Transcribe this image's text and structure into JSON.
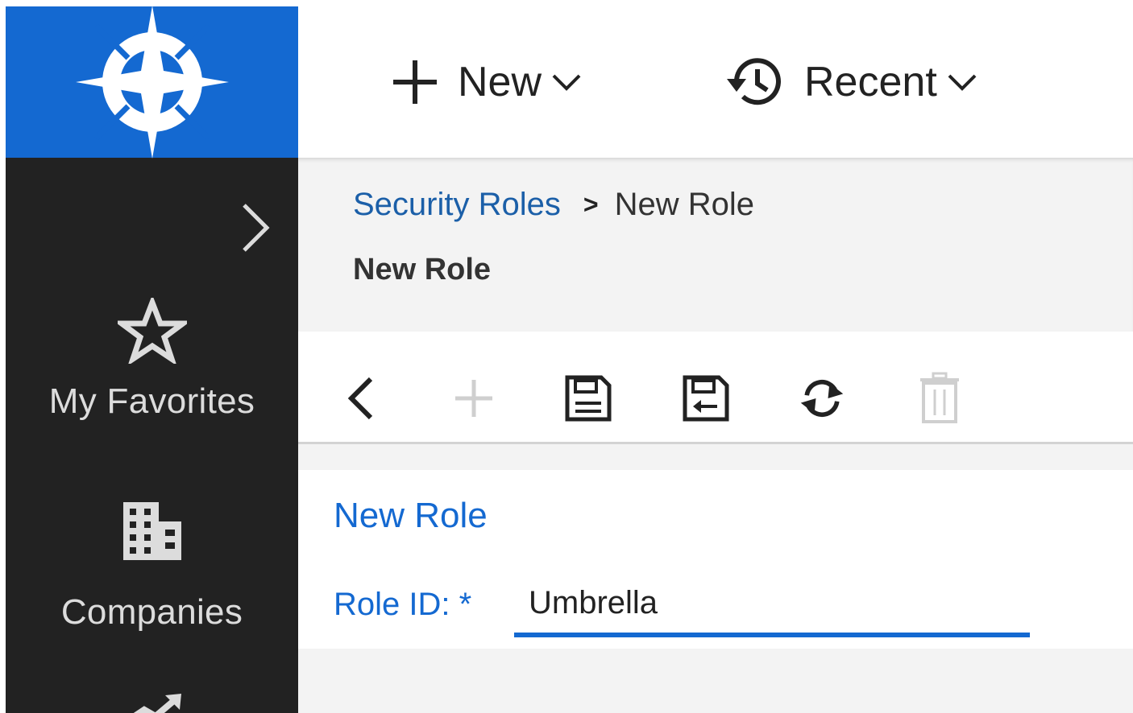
{
  "sidebar": {
    "logo_icon": "compass-star-logo",
    "expand_icon": "chevron-right-icon",
    "items": [
      {
        "icon": "star-outline-icon",
        "label": "My Favorites"
      },
      {
        "icon": "building-icon",
        "label": "Companies"
      },
      {
        "icon": "trending-up-icon",
        "label": ""
      }
    ]
  },
  "topbar": {
    "new_label": "New",
    "recent_label": "Recent"
  },
  "breadcrumb": {
    "parent": "Security Roles",
    "separator": ">",
    "current": "New Role"
  },
  "page": {
    "title": "New Role"
  },
  "toolbar": {
    "buttons": [
      {
        "icon": "back-icon",
        "enabled": true
      },
      {
        "icon": "add-icon",
        "enabled": false
      },
      {
        "icon": "save-icon",
        "enabled": true
      },
      {
        "icon": "save-and-close-icon",
        "enabled": true
      },
      {
        "icon": "refresh-icon",
        "enabled": true
      },
      {
        "icon": "delete-icon",
        "enabled": false
      }
    ]
  },
  "form": {
    "title": "New Role",
    "role_id_label": "Role ID: *",
    "role_id_value": "Umbrella"
  },
  "colors": {
    "brand_blue": "#1469d1",
    "sidebar_bg": "#222222",
    "link_blue": "#1b5fa8",
    "header_bg": "#f3f3f3"
  }
}
